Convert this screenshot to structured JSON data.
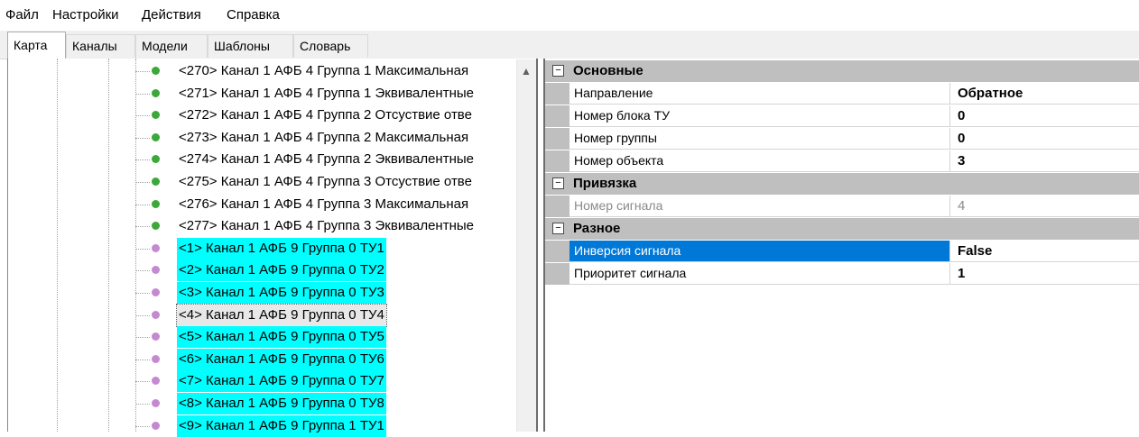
{
  "menu": [
    "Файл",
    "Настройки",
    "Действия",
    "Справка"
  ],
  "tabs": [
    "Карта",
    "Каналы",
    "Модели",
    "Шаблоны",
    "Словарь"
  ],
  "active_tab": "Карта",
  "tree": {
    "items": [
      {
        "label": "<270> Канал 1 АФБ 4 Группа 1 Максимальная",
        "dot": "green",
        "state": "normal"
      },
      {
        "label": "<271> Канал 1 АФБ 4 Группа 1 Эквивалентные",
        "dot": "green",
        "state": "normal"
      },
      {
        "label": "<272> Канал 1 АФБ 4 Группа 2 Отсуствие отве",
        "dot": "green",
        "state": "normal"
      },
      {
        "label": "<273> Канал 1 АФБ 4 Группа 2 Максимальная",
        "dot": "green",
        "state": "normal"
      },
      {
        "label": "<274> Канал 1 АФБ 4 Группа 2 Эквивалентные",
        "dot": "green",
        "state": "normal"
      },
      {
        "label": "<275> Канал 1 АФБ 4 Группа 3 Отсуствие отве",
        "dot": "green",
        "state": "normal"
      },
      {
        "label": "<276> Канал 1 АФБ 4 Группа 3 Максимальная",
        "dot": "green",
        "state": "normal"
      },
      {
        "label": "<277> Канал 1 АФБ 4 Группа 3 Эквивалентные",
        "dot": "green",
        "state": "normal"
      },
      {
        "label": "<1> Канал 1 АФБ 9 Группа 0 ТУ1",
        "dot": "violet",
        "state": "selected"
      },
      {
        "label": "<2> Канал 1 АФБ 9 Группа 0 ТУ2",
        "dot": "violet",
        "state": "selected"
      },
      {
        "label": "<3> Канал 1 АФБ 9 Группа 0 ТУ3",
        "dot": "violet",
        "state": "selected"
      },
      {
        "label": "<4> Канал 1 АФБ 9 Группа 0 ТУ4",
        "dot": "violet",
        "state": "focused"
      },
      {
        "label": "<5> Канал 1 АФБ 9 Группа 0 ТУ5",
        "dot": "violet",
        "state": "selected"
      },
      {
        "label": "<6> Канал 1 АФБ 9 Группа 0 ТУ6",
        "dot": "violet",
        "state": "selected"
      },
      {
        "label": "<7> Канал 1 АФБ 9 Группа 0 ТУ7",
        "dot": "violet",
        "state": "selected"
      },
      {
        "label": "<8> Канал 1 АФБ 9 Группа 0 ТУ8",
        "dot": "violet",
        "state": "selected"
      },
      {
        "label": "<9> Канал 1 АФБ 9 Группа 1 ТУ1",
        "dot": "violet",
        "state": "selected"
      }
    ]
  },
  "properties": {
    "categories": [
      {
        "name": "Основные",
        "toggle": "⊟",
        "rows": [
          {
            "name": "Направление",
            "value": "Обратное",
            "state": "normal"
          },
          {
            "name": "Номер блока ТУ",
            "value": "0",
            "state": "normal"
          },
          {
            "name": "Номер группы",
            "value": "0",
            "state": "normal"
          },
          {
            "name": "Номер объекта",
            "value": "3",
            "state": "normal"
          }
        ]
      },
      {
        "name": "Привязка",
        "toggle": "⊟",
        "rows": [
          {
            "name": "Номер сигнала",
            "value": "4",
            "state": "disabled"
          }
        ]
      },
      {
        "name": "Разное",
        "toggle": "⊟",
        "rows": [
          {
            "name": "Инверсия сигнала",
            "value": "False",
            "state": "selected"
          },
          {
            "name": "Приоритет сигнала",
            "value": "1",
            "state": "normal"
          }
        ]
      }
    ]
  },
  "colors": {
    "selection_cyan": "#00ffff",
    "property_selected": "#0078d7",
    "category_gray": "#bfbfbf",
    "dot_green": "#3ba839",
    "dot_violet": "#c48ad0"
  },
  "icons": {
    "scroll_up": "▲",
    "collapse": "−"
  }
}
